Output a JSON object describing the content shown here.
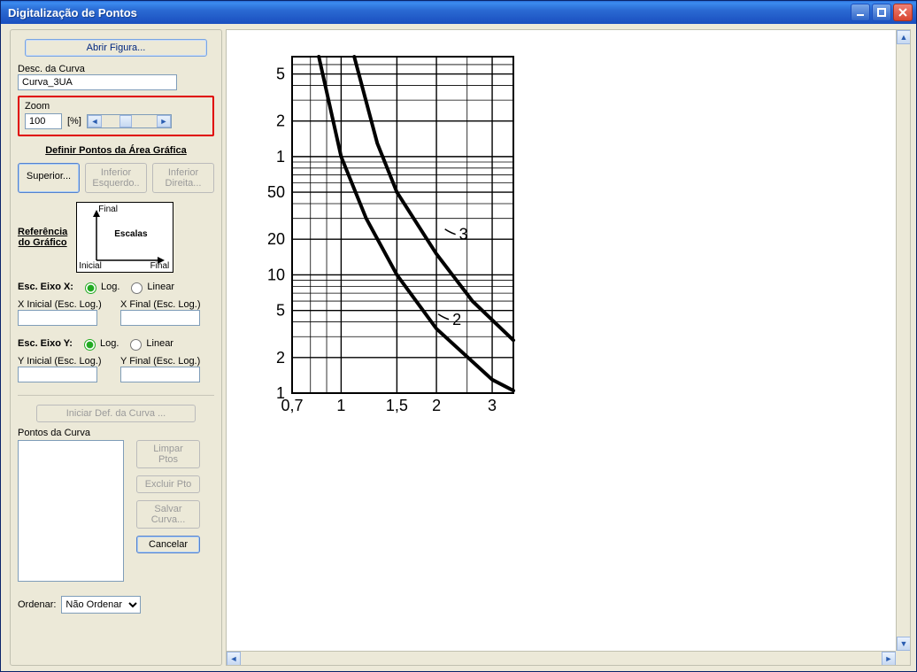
{
  "window": {
    "title": "Digitalização de Pontos"
  },
  "toolbar": {
    "open_figure": "Abrir Figura..."
  },
  "curve_desc": {
    "label": "Desc. da Curva",
    "value": "Curva_3UA"
  },
  "zoom": {
    "label": "Zoom",
    "value": "100",
    "unit": "[%]"
  },
  "define_points_title": "Definir Pontos da Área Gráfica",
  "corners": {
    "superior": "Superior...",
    "inferior_esquerdo_l1": "Inferior",
    "inferior_esquerdo_l2": "Esquerdo..",
    "inferior_direita_l1": "Inferior",
    "inferior_direita_l2": "Direita..."
  },
  "reference": {
    "title_l1": "Referência",
    "title_l2": "do Gráfico",
    "final_label": "Final",
    "inicial_label": "Inicial",
    "escalas_label": "Escalas",
    "final2_label": "Final"
  },
  "axis_x": {
    "title": "Esc. Eixo X:",
    "log": "Log.",
    "linear": "Linear",
    "initial_label": "X Inicial (Esc. Log.)",
    "final_label": "X Final (Esc. Log.)",
    "initial_value": "",
    "final_value": ""
  },
  "axis_y": {
    "title": "Esc. Eixo Y:",
    "log": "Log.",
    "linear": "Linear",
    "initial_label": "Y Inicial (Esc. Log.)",
    "final_label": "Y Final (Esc. Log.)",
    "initial_value": "",
    "final_value": ""
  },
  "start_curve_def": "Iniciar Def. da Curva ...",
  "points_label": "Pontos da Curva",
  "actions": {
    "clear": "Limpar Ptos",
    "exclude": "Excluir Pto",
    "save": "Salvar Curva...",
    "cancel": "Cancelar"
  },
  "order": {
    "label": "Ordenar:",
    "selected": "Não Ordenar",
    "options": [
      "Não Ordenar"
    ]
  },
  "chart_data": {
    "type": "line",
    "xscale": "log",
    "yscale": "log",
    "xticks": [
      0.7,
      1,
      1.5,
      2,
      3
    ],
    "yticks": [
      1,
      2,
      5,
      10,
      20,
      50,
      100,
      200,
      500
    ],
    "ytick_labels": [
      "1",
      "2",
      "5",
      "10",
      "20",
      "50",
      "1",
      "2",
      "5"
    ],
    "xlim": [
      0.7,
      3.5
    ],
    "ylim": [
      1,
      700
    ],
    "series": [
      {
        "name": "2",
        "points": [
          [
            0.85,
            700
          ],
          [
            1,
            100
          ],
          [
            1.2,
            30
          ],
          [
            1.5,
            10
          ],
          [
            2,
            3.5
          ],
          [
            3,
            1.3
          ],
          [
            3.5,
            1.05
          ]
        ]
      },
      {
        "name": "3",
        "points": [
          [
            1.1,
            700
          ],
          [
            1.3,
            130
          ],
          [
            1.5,
            50
          ],
          [
            2,
            15
          ],
          [
            2.6,
            6
          ],
          [
            3.5,
            2.8
          ]
        ]
      }
    ],
    "annotations": [
      {
        "text": "2",
        "x": 2.0,
        "y": 4.2
      },
      {
        "text": "3",
        "x": 2.1,
        "y": 22
      }
    ]
  }
}
